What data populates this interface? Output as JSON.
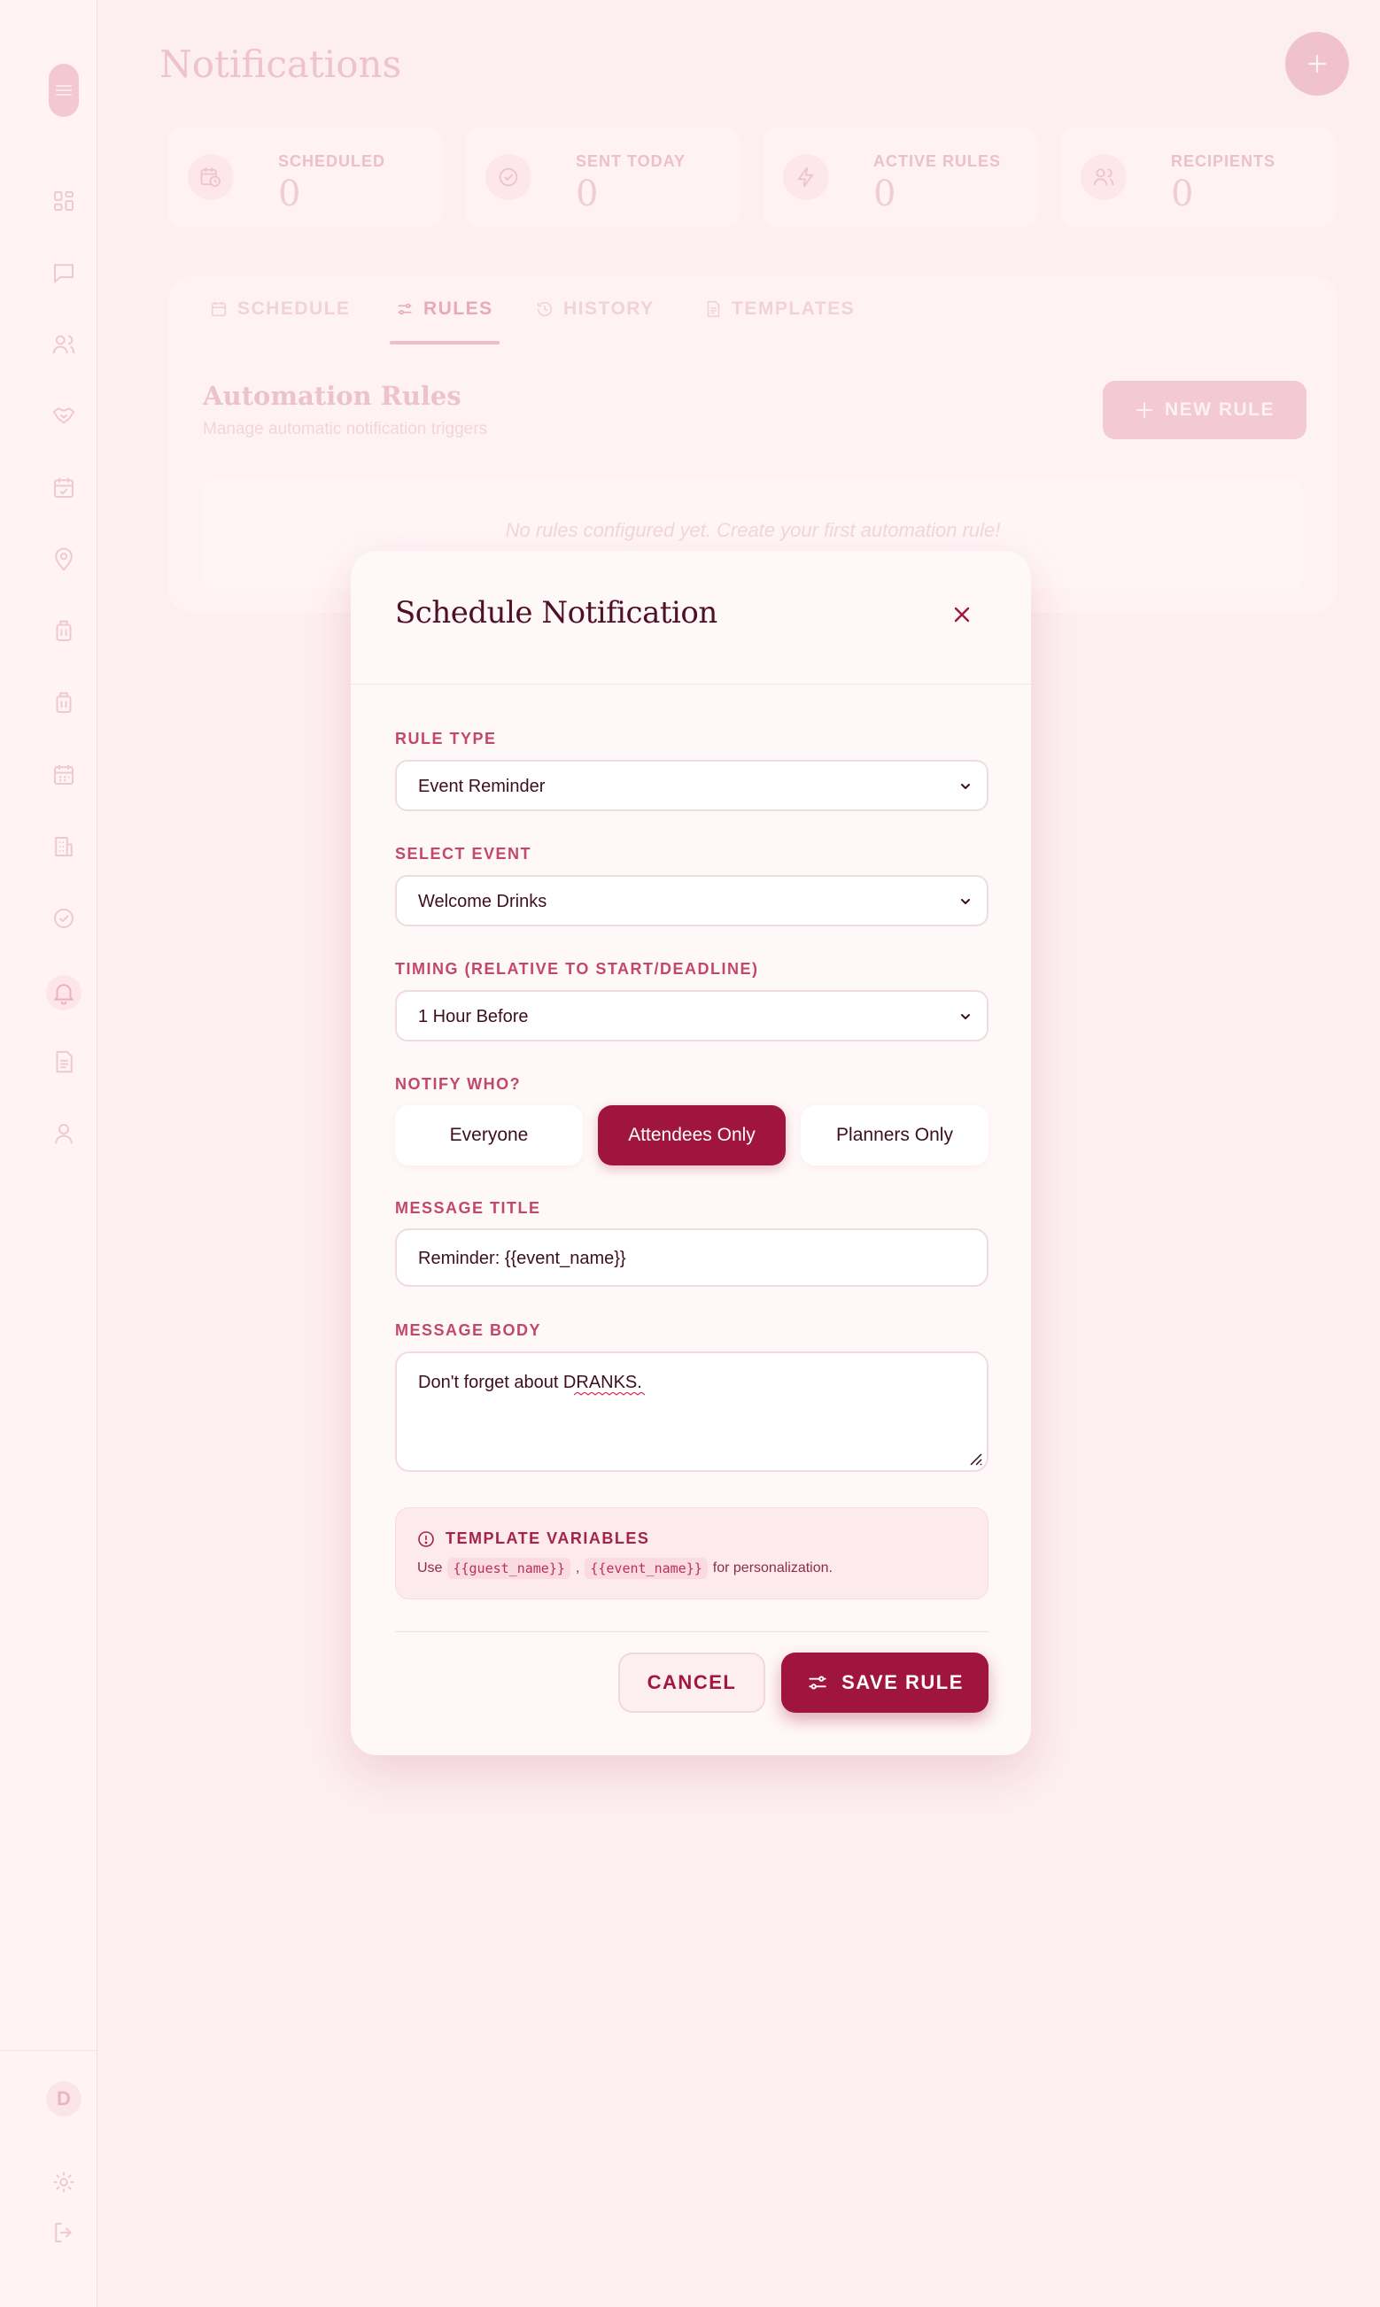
{
  "page": {
    "title": "Notifications"
  },
  "stats": [
    {
      "label": "SCHEDULED",
      "value": "0",
      "icon": "calendar-clock-icon"
    },
    {
      "label": "SENT TODAY",
      "value": "0",
      "icon": "check-circle-icon"
    },
    {
      "label": "ACTIVE RULES",
      "value": "0",
      "icon": "lightning-icon"
    },
    {
      "label": "RECIPIENTS",
      "value": "0",
      "icon": "users-icon"
    }
  ],
  "tabs": [
    {
      "label": "SCHEDULE",
      "icon": "calendar-icon"
    },
    {
      "label": "RULES",
      "icon": "sliders-icon",
      "active": true
    },
    {
      "label": "HISTORY",
      "icon": "history-icon"
    },
    {
      "label": "TEMPLATES",
      "icon": "document-icon"
    }
  ],
  "rules": {
    "title": "Automation Rules",
    "subtitle": "Manage automatic notification triggers",
    "new_button": "NEW RULE",
    "empty_message": "No rules configured yet. Create your first automation rule!"
  },
  "sidebar": {
    "avatar_initial": "D",
    "icons": [
      "dashboard-icon",
      "chat-icon",
      "users-icon",
      "handshake-icon",
      "calendar-check-icon",
      "map-pin-icon",
      "luggage-icon",
      "luggage-icon",
      "calendar-icon",
      "building-icon",
      "check-circle-icon",
      "bell-icon",
      "document-icon",
      "user-icon"
    ]
  },
  "modal": {
    "title": "Schedule Notification",
    "rule_type": {
      "label": "RULE TYPE",
      "value": "Event Reminder"
    },
    "select_event": {
      "label": "SELECT EVENT",
      "value": "Welcome Drinks"
    },
    "timing": {
      "label": "TIMING (RELATIVE TO START/DEADLINE)",
      "value": "1 Hour Before"
    },
    "notify": {
      "label": "NOTIFY WHO?",
      "options": [
        "Everyone",
        "Attendees Only",
        "Planners Only"
      ],
      "selected": "Attendees Only"
    },
    "message_title": {
      "label": "MESSAGE TITLE",
      "value": "Reminder: {{event_name}}"
    },
    "message_body": {
      "label": "MESSAGE BODY",
      "value": "Don't forget about DRANKS."
    },
    "template_vars": {
      "heading": "TEMPLATE VARIABLES",
      "prefix": "Use",
      "var1": "{{guest_name}}",
      "separator": ",",
      "var2": "{{event_name}}",
      "suffix": "for personalization."
    },
    "cancel_label": "CANCEL",
    "save_label": "SAVE RULE"
  },
  "colors": {
    "accent": "#a0153e",
    "label": "#c2476c",
    "background": "#fdeef0"
  }
}
